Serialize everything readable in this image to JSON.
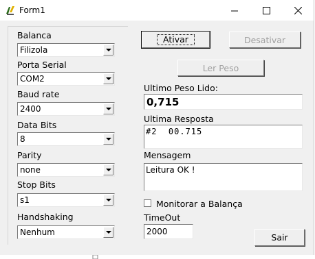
{
  "window": {
    "title": "Form1"
  },
  "config": {
    "balanca": {
      "label": "Balanca",
      "value": "Filizola"
    },
    "porta": {
      "label": "Porta Serial",
      "value": "COM2"
    },
    "baud": {
      "label": "Baud rate",
      "value": "2400"
    },
    "databits": {
      "label": "Data Bits",
      "value": "8"
    },
    "parity": {
      "label": "Parity",
      "value": "none"
    },
    "stopbits": {
      "label": "Stop Bits",
      "value": "s1"
    },
    "handshaking": {
      "label": "Handshaking",
      "value": "Nenhum"
    }
  },
  "buttons": {
    "ativar": "Ativar",
    "desativar": "Desativar",
    "ler_peso": "Ler Peso",
    "sair": "Sair"
  },
  "ultimo_peso": {
    "label": "Ultimo Peso Lido:",
    "value": "0,715"
  },
  "ultima_resposta": {
    "label": "Ultima Resposta",
    "value": "#2  00.715"
  },
  "mensagem": {
    "label": "Mensagem",
    "value": "Leitura OK !"
  },
  "monitorar": {
    "label": "Monitorar a Balança",
    "checked": false
  },
  "timeout": {
    "label": "TimeOut",
    "value": "2000"
  }
}
